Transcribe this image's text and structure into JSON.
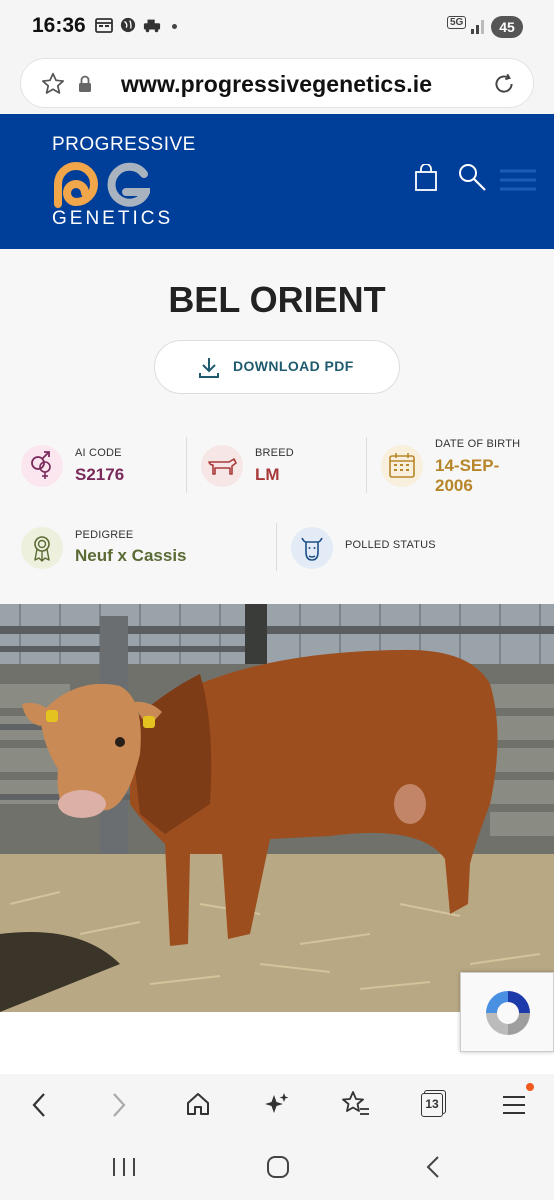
{
  "status_bar": {
    "time": "16:36",
    "network": "5G",
    "battery": "45"
  },
  "browser": {
    "url": "www.progressivegenetics.ie",
    "tab_count": "13"
  },
  "site": {
    "logo_top": "PROGRESSIVE",
    "logo_bottom": "GENETICS"
  },
  "product": {
    "name": "BEL ORIENT",
    "download_label": "DOWNLOAD PDF",
    "ai_code": {
      "label": "AI CODE",
      "value": "S2176"
    },
    "breed": {
      "label": "BREED",
      "value": "LM"
    },
    "dob": {
      "label": "DATE OF BIRTH",
      "value_line1": "14-SEP-",
      "value_line2": "2006"
    },
    "pedigree": {
      "label": "PEDIGREE",
      "value": "Neuf x Cassis"
    },
    "polled": {
      "label": "POLLED STATUS"
    }
  },
  "colors": {
    "header_blue": "#003f99",
    "ai_code_value": "#7a2a5a",
    "breed_value": "#a83a3a",
    "dob_value": "#b8862a",
    "pedigree_value": "#5a6a34",
    "download_text": "#1f5a6e"
  }
}
